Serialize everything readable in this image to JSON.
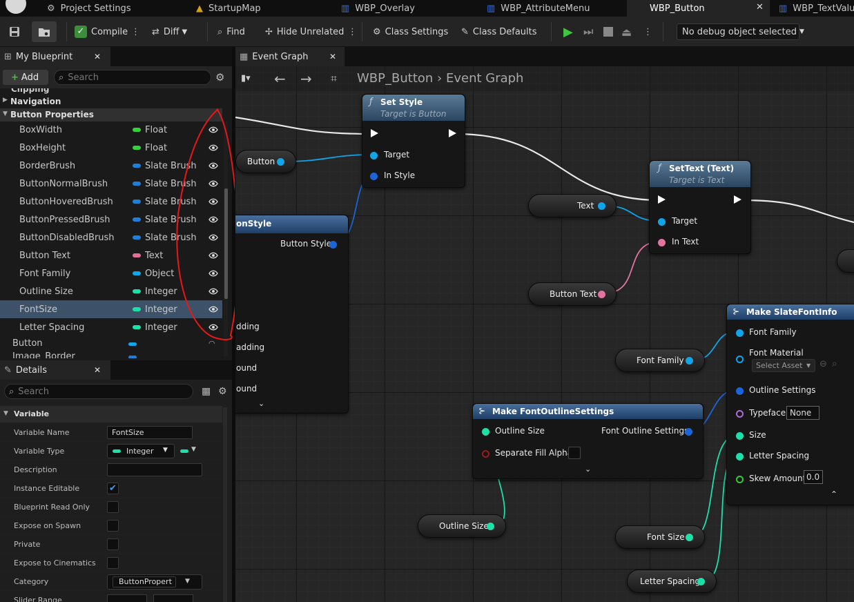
{
  "tabs": [
    {
      "label": "Project Settings"
    },
    {
      "label": "StartupMap"
    },
    {
      "label": "WBP_Overlay"
    },
    {
      "label": "WBP_AttributeMenu"
    },
    {
      "label": "WBP_Button",
      "active": true
    },
    {
      "label": "WBP_TextValu"
    }
  ],
  "toolbar": {
    "compile": "Compile",
    "diff": "Diff",
    "find": "Find",
    "hide_unrelated": "Hide Unrelated",
    "class_settings": "Class Settings",
    "class_defaults": "Class Defaults",
    "debug_object": "No debug object selected"
  },
  "my_blueprint": {
    "tab_label": "My Blueprint",
    "add_label": "Add",
    "search_placeholder": "Search",
    "clipped_top": "Clipping",
    "navigation": "Navigation",
    "section": "Button Properties",
    "variables": [
      {
        "name": "BoxWidth",
        "type": "Float",
        "color": "#35d13a"
      },
      {
        "name": "BoxHeight",
        "type": "Float",
        "color": "#35d13a"
      },
      {
        "name": "BorderBrush",
        "type": "Slate Brush",
        "color": "#1e7fd8"
      },
      {
        "name": "ButtonNormalBrush",
        "type": "Slate Brush",
        "color": "#1e7fd8"
      },
      {
        "name": "ButtonHoveredBrush",
        "type": "Slate Brush",
        "color": "#1e7fd8"
      },
      {
        "name": "ButtonPressedBrush",
        "type": "Slate Brush",
        "color": "#1e7fd8"
      },
      {
        "name": "ButtonDisabledBrush",
        "type": "Slate Brush",
        "color": "#1e7fd8"
      },
      {
        "name": "Button Text",
        "type": "Text",
        "color": "#e36f98"
      },
      {
        "name": "Font Family",
        "type": "Object",
        "color": "#11a6e8"
      },
      {
        "name": "Outline Size",
        "type": "Integer",
        "color": "#1de0a8"
      },
      {
        "name": "FontSize",
        "type": "Integer",
        "color": "#1de0a8",
        "selected": true
      },
      {
        "name": "Letter Spacing",
        "type": "Integer",
        "color": "#1de0a8"
      }
    ],
    "extra": [
      "Button",
      "Image_Border"
    ]
  },
  "details": {
    "tab_label": "Details",
    "search_placeholder": "Search",
    "section": "Variable",
    "variable_name_label": "Variable Name",
    "variable_name_value": "FontSize",
    "variable_type_label": "Variable Type",
    "variable_type_value": "Integer",
    "description_label": "Description",
    "instance_editable_label": "Instance Editable",
    "blueprint_read_only_label": "Blueprint Read Only",
    "expose_on_spawn_label": "Expose on Spawn",
    "private_label": "Private",
    "expose_to_cinematics_label": "Expose to Cinematics",
    "category_label": "Category",
    "category_value": "ButtonPropert",
    "slider_range_label": "Slider Range"
  },
  "graph": {
    "tab_label": "Event Graph",
    "breadcrumb_asset": "WBP_Button",
    "breadcrumb_graph": "Event Graph",
    "set_style": {
      "title": "Set Style",
      "subtitle": "Target is Button",
      "target": "Target",
      "in_style": "In Style"
    },
    "set_text": {
      "title": "SetText (Text)",
      "subtitle": "Target is Text",
      "target": "Target",
      "in_text": "In Text"
    },
    "button_var": "Button",
    "text_var": "Text",
    "button_text_var": "Button Text",
    "partial_node": {
      "title": "onStyle",
      "output": "Button Style",
      "rows": [
        "dding",
        "adding",
        "ound",
        "ound"
      ]
    },
    "make_font_info": {
      "title": "Make SlateFontInfo",
      "font_family": "Font Family",
      "font_material": "Font Material",
      "select_asset": "Select Asset",
      "outline_settings": "Outline Settings",
      "typeface": "Typeface",
      "typeface_value": "None",
      "size": "Size",
      "letter_spacing": "Letter Spacing",
      "skew_amount": "Skew Amount",
      "skew_value": "0.0"
    },
    "make_outline": {
      "title": "Make FontOutlineSettings",
      "outline_size": "Outline Size",
      "separate_fill_alpha": "Separate Fill Alpha",
      "output": "Font Outline Settings"
    },
    "font_family_var": "Font Family",
    "outline_size_var": "Outline Size",
    "font_size_var": "Font Size",
    "letter_spacing_var": "Letter Spacing"
  }
}
